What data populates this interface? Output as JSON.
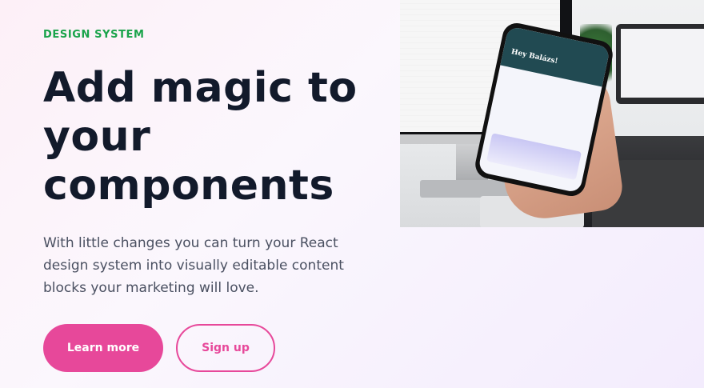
{
  "hero": {
    "eyebrow": "DESIGN SYSTEM",
    "headline_line1": "Add magic to",
    "headline_line2": "your",
    "headline_line3": "components",
    "subhead": "With little changes you can turn your React design system into visually editable content blocks your marketing will love."
  },
  "actions": {
    "primary_label": "Learn more",
    "secondary_label": "Sign up"
  },
  "photo": {
    "phone_greeting": "Hey Balázs!"
  },
  "colors": {
    "accent": "#e7489a",
    "eyebrow": "#19a34a",
    "heading": "#121a2b",
    "body_text": "#4a5061"
  }
}
